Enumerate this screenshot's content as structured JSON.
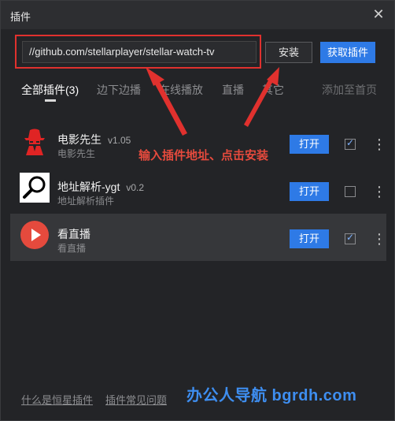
{
  "window": {
    "title": "插件",
    "close_glyph": "✕"
  },
  "install_bar": {
    "url_value": "//github.com/stellarplayer/stellar-watch-tv",
    "install_label": "安装",
    "get_plugins_label": "获取插件"
  },
  "tabs": {
    "items": [
      {
        "label": "全部插件(3)",
        "active": true
      },
      {
        "label": "边下边播",
        "active": false
      },
      {
        "label": "在线播放",
        "active": false
      },
      {
        "label": "直播",
        "active": false
      },
      {
        "label": "其它",
        "active": false
      }
    ],
    "add_home": "添加至首页"
  },
  "plugins": [
    {
      "name": "电影先生",
      "version": "v1.05",
      "desc": "电影先生",
      "open_label": "打开",
      "enabled": true,
      "icon": "red-spy-icon",
      "icon_color": "#e02424"
    },
    {
      "name": "地址解析-ygt",
      "version": "v0.2",
      "desc": "地址解析插件",
      "open_label": "打开",
      "enabled": false,
      "icon": "magnifier-icon",
      "icon_color": "#000000"
    },
    {
      "name": "看直播",
      "version": "",
      "desc": "看直播",
      "open_label": "打开",
      "enabled": true,
      "icon": "play-circle-icon",
      "icon_color": "#e54a3d"
    }
  ],
  "annotation": "输入插件地址、点击安装",
  "footer": {
    "link_what": "什么是恒星插件",
    "link_faq": "插件常见问题"
  },
  "watermark": "办公人导航 bgrdh.com",
  "colors": {
    "accent": "#2e7ae6",
    "annotation_red": "#e0312e",
    "watermark_blue": "#3e8ef0"
  }
}
